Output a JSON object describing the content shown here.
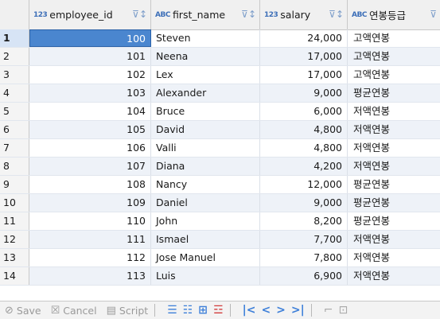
{
  "columns": [
    {
      "type": "123",
      "name": "employee_id"
    },
    {
      "type": "ABC",
      "name": "first_name"
    },
    {
      "type": "123",
      "name": "salary"
    },
    {
      "type": "ABC",
      "name": "연봉등급"
    }
  ],
  "rows": [
    {
      "n": "1",
      "id": "100",
      "first_name": "Steven",
      "salary": "24,000",
      "grade": "고액연봉"
    },
    {
      "n": "2",
      "id": "101",
      "first_name": "Neena",
      "salary": "17,000",
      "grade": "고액연봉"
    },
    {
      "n": "3",
      "id": "102",
      "first_name": "Lex",
      "salary": "17,000",
      "grade": "고액연봉"
    },
    {
      "n": "4",
      "id": "103",
      "first_name": "Alexander",
      "salary": "9,000",
      "grade": "평균연봉"
    },
    {
      "n": "5",
      "id": "104",
      "first_name": "Bruce",
      "salary": "6,000",
      "grade": "저액연봉"
    },
    {
      "n": "6",
      "id": "105",
      "first_name": "David",
      "salary": "4,800",
      "grade": "저액연봉"
    },
    {
      "n": "7",
      "id": "106",
      "first_name": "Valli",
      "salary": "4,800",
      "grade": "저액연봉"
    },
    {
      "n": "8",
      "id": "107",
      "first_name": "Diana",
      "salary": "4,200",
      "grade": "저액연봉"
    },
    {
      "n": "9",
      "id": "108",
      "first_name": "Nancy",
      "salary": "12,000",
      "grade": "평균연봉"
    },
    {
      "n": "10",
      "id": "109",
      "first_name": "Daniel",
      "salary": "9,000",
      "grade": "평균연봉"
    },
    {
      "n": "11",
      "id": "110",
      "first_name": "John",
      "salary": "8,200",
      "grade": "평균연봉"
    },
    {
      "n": "12",
      "id": "111",
      "first_name": "Ismael",
      "salary": "7,700",
      "grade": "저액연봉"
    },
    {
      "n": "13",
      "id": "112",
      "first_name": "Jose Manuel",
      "salary": "7,800",
      "grade": "저액연봉"
    },
    {
      "n": "14",
      "id": "113",
      "first_name": "Luis",
      "salary": "6,900",
      "grade": "저액연봉"
    }
  ],
  "toolbar": {
    "save_label": "Save",
    "cancel_label": "Cancel",
    "script_label": "Script"
  },
  "colors": {
    "selection": "#4a86cf",
    "alt_row": "#eef2f8",
    "accent": "#3d7fd9"
  }
}
